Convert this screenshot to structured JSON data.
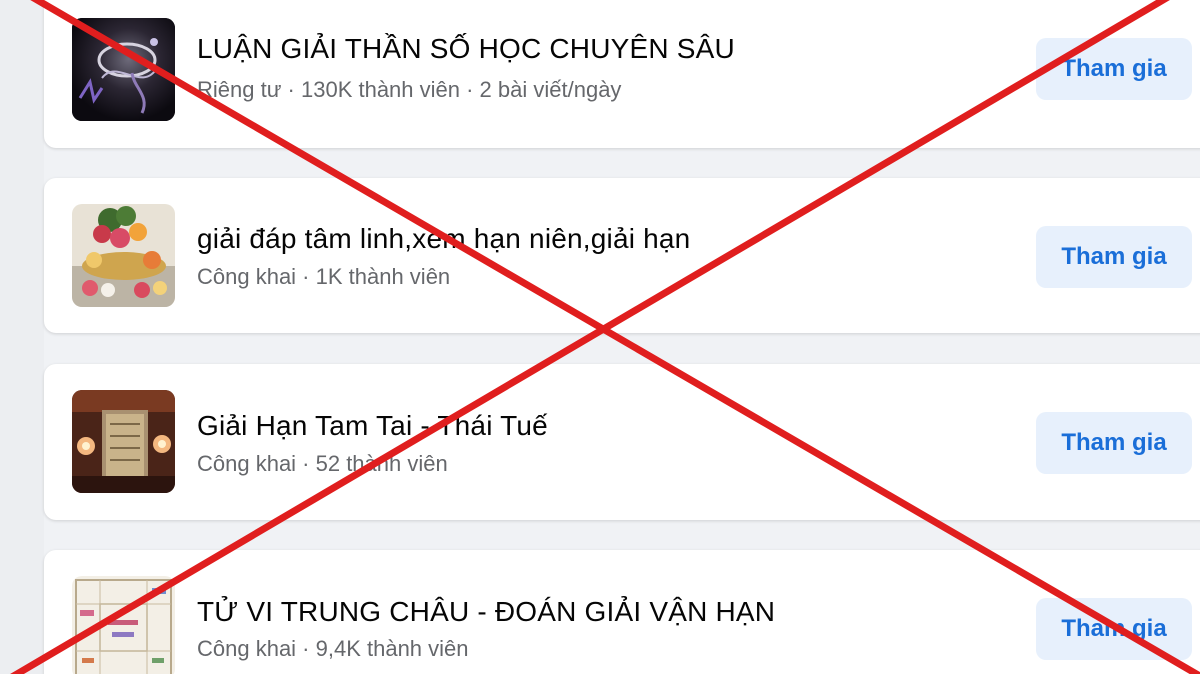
{
  "groups": [
    {
      "name": "LUẬN GIẢI THẦN SỐ HỌC CHUYÊN SÂU",
      "meta": "Riêng tư · 130K thành viên · 2 bài viết/ngày",
      "join_label": "Tham gia",
      "avatar": "dark-numerology-image"
    },
    {
      "name": "giải đáp tâm linh,xem hạn niên,giải hạn",
      "meta": "Công khai · 1K thành viên",
      "join_label": "Tham gia",
      "avatar": "offering-tray-image"
    },
    {
      "name": "Giải Hạn Tam Tai - Thái Tuế",
      "meta": "Công khai · 52 thành viên",
      "join_label": "Tham gia",
      "avatar": "altar-candles-image"
    },
    {
      "name": "TỬ VI TRUNG CHÂU - ĐOÁN GIẢI VẬN HẠN",
      "meta": "Công khai · 9,4K thành viên",
      "join_label": "Tham gia",
      "avatar": "astrology-chart-image"
    }
  ],
  "overlay": {
    "mark": "red-x-cross",
    "color": "#e01e1e"
  },
  "colors": {
    "background": "#f0f2f5",
    "card": "#ffffff",
    "title": "#050505",
    "meta": "#65676b",
    "button_bg": "#e7f0fc",
    "button_text": "#1a6ed8"
  }
}
